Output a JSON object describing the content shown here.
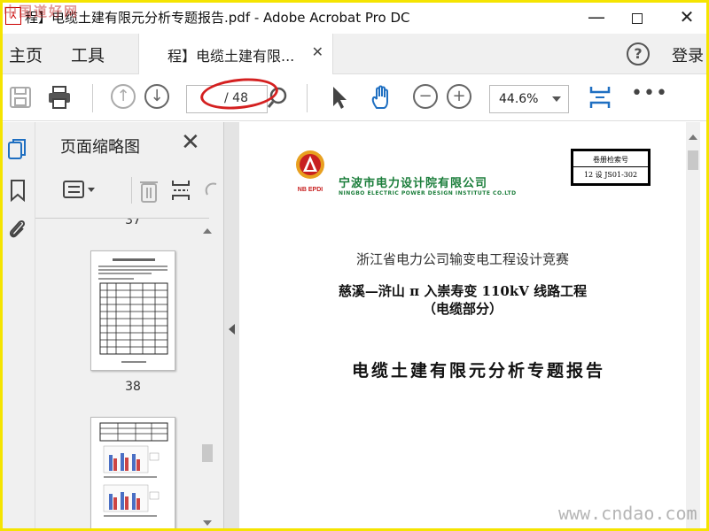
{
  "watermarks": {
    "top": "中国道好网",
    "bottom": "www.cndao.com"
  },
  "window": {
    "title": "程】电缆土建有限元分析专题报告.pdf - Adobe Acrobat Pro DC",
    "app_icon": "pdf-icon"
  },
  "menu": {
    "home": "主页",
    "tools": "工具",
    "doc_tab": "程】电缆土建有限...",
    "login": "登录"
  },
  "toolbar": {
    "current_page": "",
    "total_pages": "/ 48",
    "zoom": "44.6%"
  },
  "thumbnails": {
    "title": "页面缩略图",
    "page_numbers": [
      "37",
      "38"
    ]
  },
  "document": {
    "company_cn": "宁波市电力设计院有限公司",
    "company_en": "NINGBO ELECTRIC POWER DESIGN INSTITUTE CO.LTD",
    "logo_text": "NB EPDI",
    "ref_label": "卷册检索号",
    "ref_value": "12 设 JS01-302",
    "competition": "浙江省电力公司输变电工程设计竞赛",
    "project": "慈溪—浒山 π 入崇寿变 110kV 线路工程",
    "part": "（电缆部分）",
    "report_title": "电缆土建有限元分析专题报告"
  },
  "colors": {
    "accent_blue": "#1f6fc1",
    "annotation_red": "#d42020",
    "company_green": "#1a7d3a",
    "frame_yellow": "#f5e400"
  }
}
